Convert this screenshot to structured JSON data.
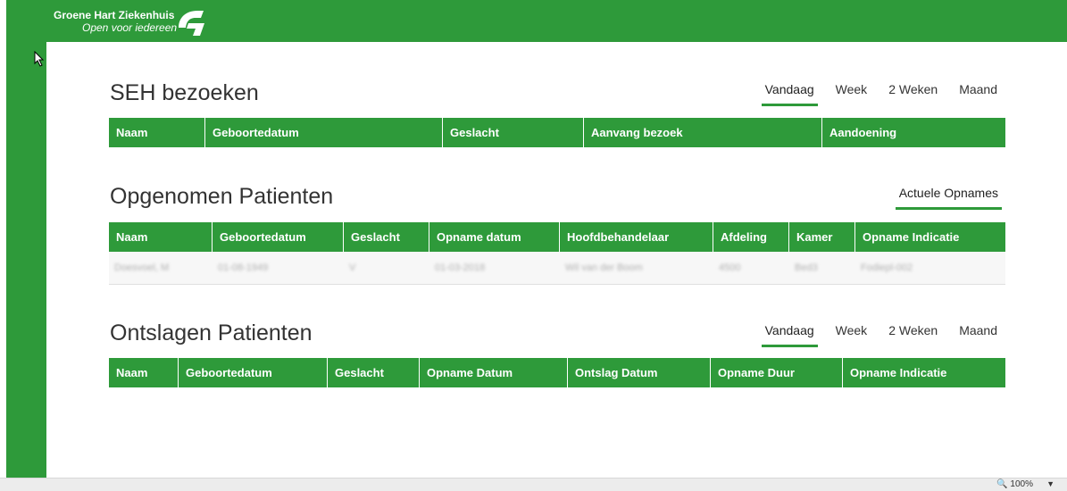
{
  "brand": {
    "name": "Groene Hart Ziekenhuis",
    "tagline": "Open voor iedereen",
    "color": "#2e9a3a"
  },
  "seh": {
    "title": "SEH bezoeken",
    "tabs": [
      "Vandaag",
      "Week",
      "2 Weken",
      "Maand"
    ],
    "active_tab": "Vandaag",
    "columns": [
      "Naam",
      "Geboortedatum",
      "Geslacht",
      "Aanvang bezoek",
      "Aandoening"
    ]
  },
  "opgenomen": {
    "title": "Opgenomen Patienten",
    "tabs": [
      "Actuele Opnames"
    ],
    "active_tab": "Actuele Opnames",
    "columns": [
      "Naam",
      "Geboortedatum",
      "Geslacht",
      "Opname datum",
      "Hoofdbehandelaar",
      "Afdeling",
      "Kamer",
      "Opname Indicatie"
    ],
    "rows": [
      [
        "Doesvoel, M",
        "01-08-1949",
        "V",
        "01-03-2018",
        "Wil van der Boom",
        "4500",
        "Bed3",
        "Fodiepl-002"
      ]
    ]
  },
  "ontslagen": {
    "title": "Ontslagen Patienten",
    "tabs": [
      "Vandaag",
      "Week",
      "2 Weken",
      "Maand"
    ],
    "active_tab": "Vandaag",
    "columns": [
      "Naam",
      "Geboortedatum",
      "Geslacht",
      "Opname Datum",
      "Ontslag Datum",
      "Opname Duur",
      "Opname Indicatie"
    ]
  },
  "statusbar": {
    "zoom": "100%"
  }
}
